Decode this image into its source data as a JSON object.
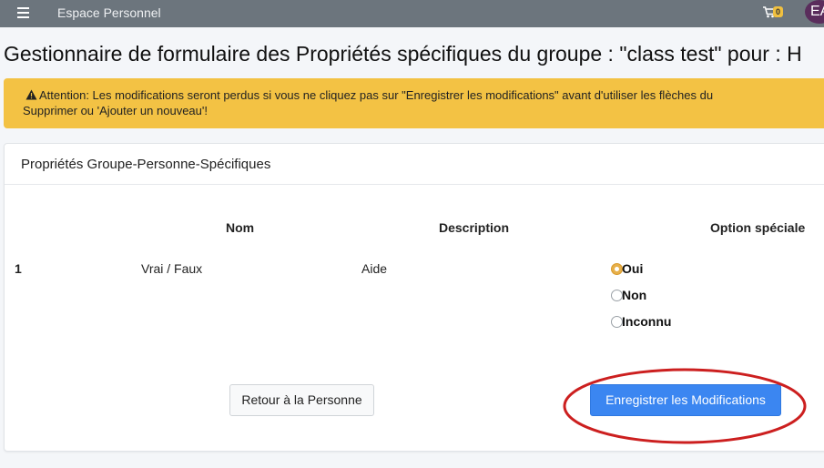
{
  "navbar": {
    "brand": "Espace Personnel",
    "cart_count": "0",
    "avatar_initials": "EA"
  },
  "page": {
    "title": "Gestionnaire de formulaire des Propriétés spécifiques du groupe : \"class test\" pour : H"
  },
  "alert": {
    "line1": "Attention: Les modifications seront perdus si vous ne cliquez pas sur \"Enregistrer les modifications\" avant d'utiliser les flèches du",
    "line2": "Supprimer ou 'Ajouter un nouveau'!"
  },
  "card": {
    "title": "Propriétés Groupe-Personne-Spécifiques",
    "columns": {
      "nom": "Nom",
      "description": "Description",
      "option": "Option spéciale"
    },
    "row": {
      "number": "1",
      "nom": "Vrai / Faux",
      "description": "Aide",
      "options": [
        {
          "label": "Oui",
          "checked": true
        },
        {
          "label": "Non",
          "checked": false
        },
        {
          "label": "Inconnu",
          "checked": false
        }
      ]
    },
    "buttons": {
      "back": "Retour à la Personne",
      "save": "Enregistrer les Modifications"
    }
  },
  "colors": {
    "navbar": "#6c757d",
    "alert": "#f3c244",
    "primary": "#3b86f1",
    "highlight": "#cc1f1f"
  }
}
